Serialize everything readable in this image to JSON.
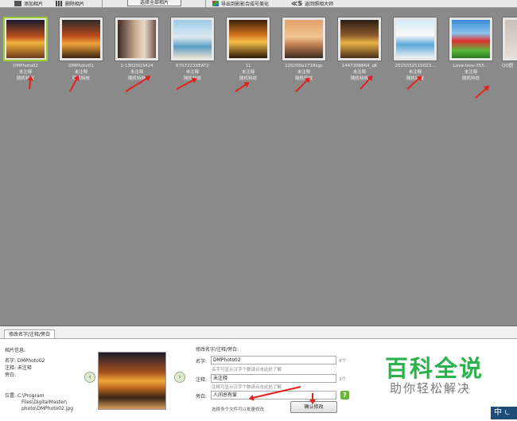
{
  "toolbar": {
    "add_photo": "添加相片",
    "delete_photo": "删除相片",
    "select_all": "选择全部相片",
    "export": "导出到影影合成号美化",
    "back": "返回照相大师"
  },
  "photos": [
    {
      "name": "DMPhoto02",
      "note": "未注释",
      "effect": "随机特效"
    },
    {
      "name": "DMPhoto01",
      "note": "未注释",
      "effect": "随机特效"
    },
    {
      "name": "1-13020Q3424",
      "note": "未注释",
      "effect": "随机特效"
    },
    {
      "name": "6757223XEAT2",
      "note": "未注释",
      "effect": "随机特效"
    },
    {
      "name": "11",
      "note": "未注释",
      "effect": "随机特效"
    },
    {
      "name": "120200a1718sgc",
      "note": "未注释",
      "effect": "随机特效"
    },
    {
      "name": "1447308864_qK",
      "note": "未注释",
      "effect": "随机特效"
    },
    {
      "name": "20150325150Z3...",
      "note": "未注释",
      "effect": "随机特效"
    },
    {
      "name": "Love-love-355...",
      "note": "未注释",
      "effect": "随机特效"
    },
    {
      "name": "QQ图",
      "note": "",
      "effect": ""
    }
  ],
  "panel": {
    "tab": "修改名字/注释/旁白",
    "info_title": "相片信息:",
    "info_name": "名字: DMPhoto02",
    "info_note": "注释: 未注释",
    "info_narr": "旁白:",
    "info_loc_1": "位置: C:\\Program",
    "info_loc_2": "Files\\DigitalMaster\\",
    "info_loc_3": "photo\\DMPhoto02.jpg",
    "edit_title": "修改名字/注释/旁白:",
    "name_label": "名字:",
    "name_value": "DMPhoto02",
    "name_count": "4个",
    "name_hint": "名字可显示汉字个数请点击此处了解",
    "note_label": "注释:",
    "note_value": "未注释",
    "note_count": "3个",
    "note_hint": "注释可显示汉字个数请点击此处了解",
    "narr_label": "旁白:",
    "narr_value": "人间总有爱",
    "help": "?",
    "batch_hint": "选择多个文件可以批量修改",
    "confirm": "确认修改"
  },
  "watermark": {
    "title": "百科全说",
    "subtitle": "助你轻松解决"
  },
  "ime": "中 ⏾",
  "nav": {
    "prev": "‹",
    "next": "›"
  }
}
